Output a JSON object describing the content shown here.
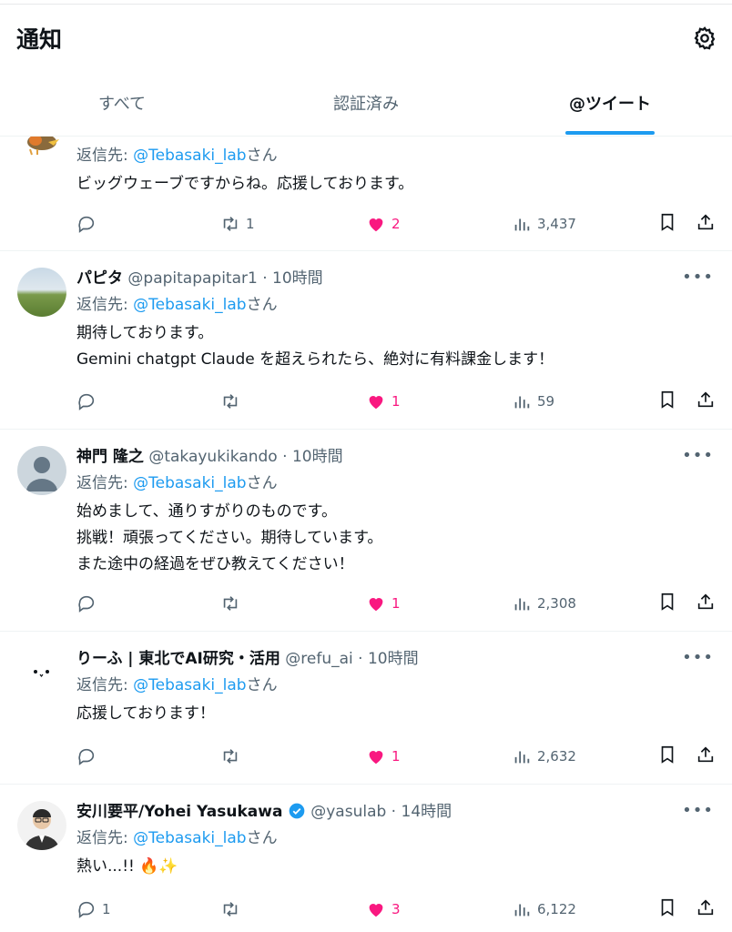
{
  "header": {
    "title": "通知"
  },
  "tabs": [
    {
      "label": "すべて"
    },
    {
      "label": "認証済み"
    },
    {
      "label": "@ツイート"
    }
  ],
  "reply_prefix": "返信先: ",
  "reply_suffix": "さん",
  "tweets": [
    {
      "name": "",
      "handle": "",
      "time": "",
      "reply_to": "@Tebasaki_lab",
      "lines": [
        "ビッグウェーブですからね。応援しております。"
      ],
      "replies": "",
      "retweets": "1",
      "likes": "2",
      "views": "3,437"
    },
    {
      "name": "パピタ",
      "handle": "@papitapapitar1",
      "time": "10時間",
      "reply_to": "@Tebasaki_lab",
      "lines": [
        "期待しております。",
        "Gemini chatgpt Claude を超えられたら、絶対に有料課金します！"
      ],
      "replies": "",
      "retweets": "",
      "likes": "1",
      "views": "59"
    },
    {
      "name": "神門 隆之",
      "handle": "@takayukikando",
      "time": "10時間",
      "reply_to": "@Tebasaki_lab",
      "lines": [
        "始めまして、通りすがりのものです。",
        "挑戦！頑張ってください。期待しています。",
        "また途中の経過をぜひ教えてください！"
      ],
      "replies": "",
      "retweets": "",
      "likes": "1",
      "views": "2,308"
    },
    {
      "name": "りーふ | 東北でAI研究・活用",
      "handle": "@refu_ai",
      "time": "10時間",
      "reply_to": "@Tebasaki_lab",
      "lines": [
        "応援しております！"
      ],
      "replies": "",
      "retweets": "",
      "likes": "1",
      "views": "2,632"
    },
    {
      "name": "安川要平/Yohei Yasukawa",
      "handle": "@yasulab",
      "time": "14時間",
      "reply_to": "@Tebasaki_lab",
      "lines": [
        "熱い...!! 🔥✨"
      ],
      "replies": "1",
      "retweets": "",
      "likes": "3",
      "views": "6,122"
    }
  ],
  "colors": {
    "accent": "#1d9bf0",
    "like": "#f91880",
    "muted": "#536471"
  }
}
